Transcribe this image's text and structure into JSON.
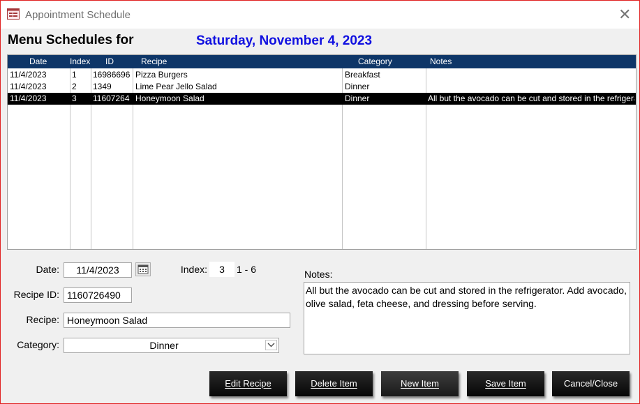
{
  "window": {
    "title": "Appointment Schedule"
  },
  "heading": {
    "label": "Menu Schedules for",
    "date": "Saturday, November 4, 2023"
  },
  "grid": {
    "columns": [
      "Date",
      "Index",
      "ID",
      "Recipe",
      "Category",
      "Notes"
    ],
    "rows": [
      {
        "date": "11/4/2023",
        "index": "1",
        "id": "16986696",
        "recipe": "Pizza Burgers",
        "category": "Breakfast",
        "notes": "",
        "selected": false
      },
      {
        "date": "11/4/2023",
        "index": "2",
        "id": "1349",
        "recipe": "Lime Pear Jello Salad",
        "category": "Dinner",
        "notes": "",
        "selected": false
      },
      {
        "date": "11/4/2023",
        "index": "3",
        "id": "11607264",
        "recipe": "Honeymoon Salad",
        "category": "Dinner",
        "notes": "All but the avocado can be cut and stored in the refrigerator. Add avocado, olive salad, feta cheese, and dressing before serving.",
        "selected": true
      }
    ]
  },
  "form": {
    "date_label": "Date:",
    "date_value": "11/4/2023",
    "index_label": "Index:",
    "index_value": "3",
    "index_range": "1 - 6",
    "recipe_id_label": "Recipe ID:",
    "recipe_id_value": "1160726490",
    "recipe_label": "Recipe:",
    "recipe_value": "Honeymoon Salad",
    "category_label": "Category:",
    "category_value": "Dinner",
    "notes_label": "Notes:",
    "notes_value": "All but the avocado can be cut and stored in the refrigerator. Add avocado, olive salad, feta cheese, and dressing before serving."
  },
  "buttons": {
    "edit_recipe": "Edit Recipe",
    "delete_item": "Delete Item",
    "new_item": "New Item",
    "save_item": "Save Item",
    "cancel_close": "Cancel/Close"
  },
  "colors": {
    "header_bg": "#0e3668",
    "date_heading": "#1010e0",
    "selected_row": "#000000",
    "window_border": "#e02020"
  },
  "icons": {
    "app": "form-icon",
    "close": "close-icon",
    "calendar": "calendar-icon",
    "dropdown": "chevron-down-icon"
  }
}
